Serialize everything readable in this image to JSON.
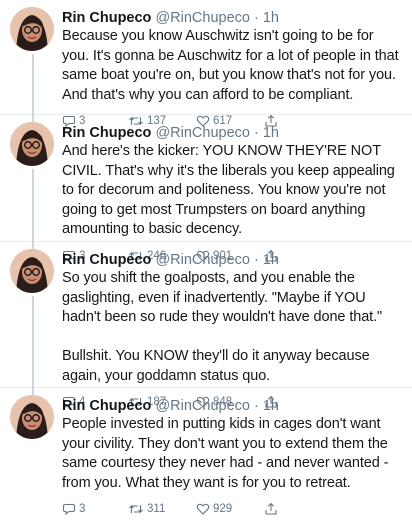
{
  "tweets": [
    {
      "name": "Rin Chupeco",
      "handle": "@RinChupeco",
      "time": "· 1h",
      "text": "Because you know Auschwitz isn't going to be for you. It's gonna be Auschwitz for a lot of people in that same boat you're on, but you know that's not for you. And that's why you can afford to be compliant.",
      "replies": "3",
      "retweets": "137",
      "likes": "617"
    },
    {
      "name": "Rin Chupeco",
      "handle": "@RinChupeco",
      "time": "· 1h",
      "text": "And here's the kicker: YOU KNOW THEY'RE NOT CIVIL. That's why it's the liberals you keep appealing to for decorum and politeness. You know you're not going to get most Trumpsters on board anything amounting to basic decency.",
      "replies": "3",
      "retweets": "246",
      "likes": "901"
    },
    {
      "name": "Rin Chupeco",
      "handle": "@RinChupeco",
      "time": "· 1h",
      "text": "So you shift the goalposts, and you enable the gaslighting, even if inadvertently. \"Maybe if YOU hadn't been so rude they wouldn't have done that.\"\n\nBullshit. You KNOW they'll do it anyway because again, your goddamn status quo.",
      "replies": "4",
      "retweets": "187",
      "likes": "848"
    },
    {
      "name": "Rin Chupeco",
      "handle": "@RinChupeco",
      "time": "· 1h",
      "text": "People invested in putting kids in cages don't want your civility. They don't want you to extend them the same courtesy they never had - and never wanted - from you. What they want is for you to retreat.",
      "replies": "3",
      "retweets": "311",
      "likes": "929"
    }
  ]
}
